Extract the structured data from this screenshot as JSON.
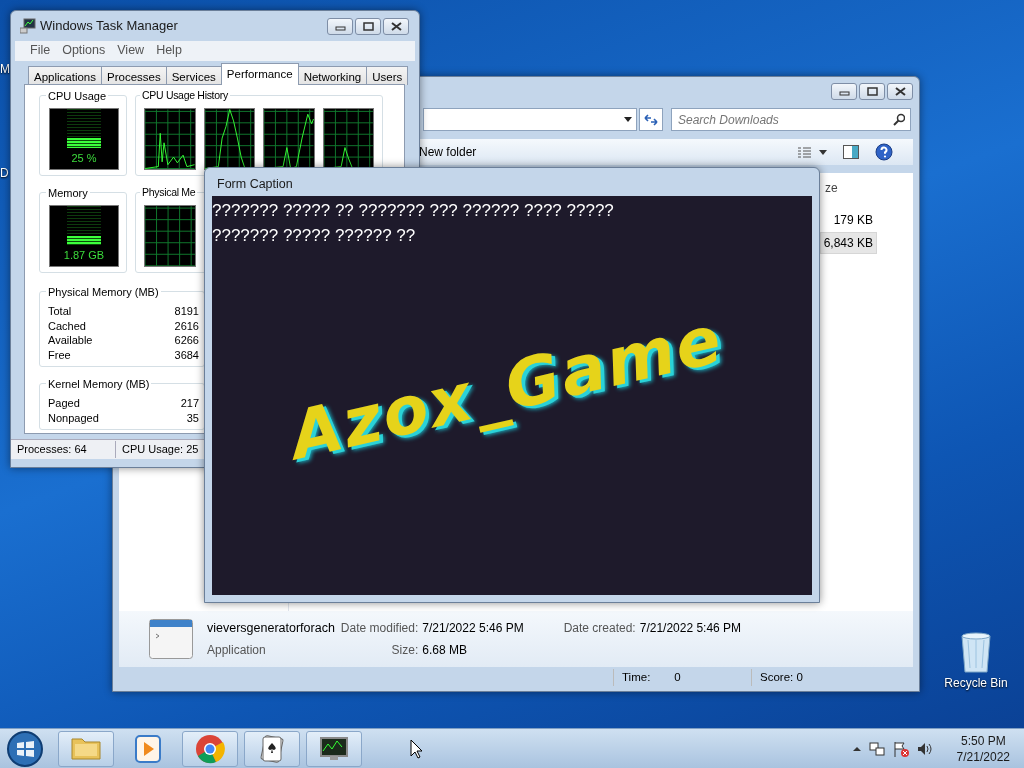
{
  "desktop_icons": [
    {
      "label": "M"
    },
    {
      "label": "D"
    }
  ],
  "task_manager": {
    "title": "Windows Task Manager",
    "menu": [
      "File",
      "Options",
      "View",
      "Help"
    ],
    "tabs": [
      {
        "label": "Applications",
        "selected": false
      },
      {
        "label": "Processes",
        "selected": false
      },
      {
        "label": "Services",
        "selected": false
      },
      {
        "label": "Performance",
        "selected": true
      },
      {
        "label": "Networking",
        "selected": false
      },
      {
        "label": "Users",
        "selected": false
      }
    ],
    "cpu_usage": {
      "title": "CPU Usage",
      "reading": "25 %",
      "level": 0.25
    },
    "cpu_history": {
      "title": "CPU Usage History"
    },
    "memory": {
      "title": "Memory",
      "reading": "1.87 GB",
      "level": 0.23
    },
    "memory_history": {
      "title": "Physical Me"
    },
    "physical_memory": {
      "title": "Physical Memory (MB)",
      "rows": [
        {
          "label": "Total",
          "value": "8191"
        },
        {
          "label": "Cached",
          "value": "2616"
        },
        {
          "label": "Available",
          "value": "6266"
        },
        {
          "label": "Free",
          "value": "3684"
        }
      ]
    },
    "kernel_memory": {
      "title": "Kernel Memory (MB)",
      "rows": [
        {
          "label": "Paged",
          "value": "217"
        },
        {
          "label": "Nonpaged",
          "value": "35"
        }
      ]
    },
    "status": [
      "Processes: 64",
      "CPU Usage: 25"
    ]
  },
  "explorer": {
    "search": {
      "placeholder": "Search Downloads"
    },
    "new_folder": "New folder",
    "column_header": "ze",
    "rows": [
      {
        "size": "179 KB",
        "selected": false
      },
      {
        "size": "6,843 KB",
        "selected": true
      }
    ],
    "details": {
      "name": "vieversgeneratorforach",
      "type": "Application",
      "date_modified_label": "Date modified:",
      "date_modified": "7/21/2022 5:46 PM",
      "date_created_label": "Date created:",
      "date_created": "7/21/2022 5:46 PM",
      "size_label": "Size:",
      "size": "6.68 MB"
    },
    "status": [
      {
        "label": "Time:",
        "value": "0"
      },
      {
        "label": "Score: 0"
      }
    ]
  },
  "form": {
    "caption": "Form Caption",
    "lines": [
      "??????? ????? ?? ??????? ??? ?????? ???? ?????",
      "??????? ????? ?????? ??"
    ],
    "logo": "Azox_Game"
  },
  "recycle_bin": {
    "label": "Recycle Bin"
  },
  "taskbar": {
    "apps": [
      {
        "kind": "folder"
      },
      {
        "kind": "media"
      },
      {
        "kind": "browser"
      },
      {
        "kind": "cards"
      },
      {
        "kind": "monitor"
      }
    ],
    "clock": {
      "time": "5:50 PM",
      "date": "7/21/2022"
    }
  }
}
